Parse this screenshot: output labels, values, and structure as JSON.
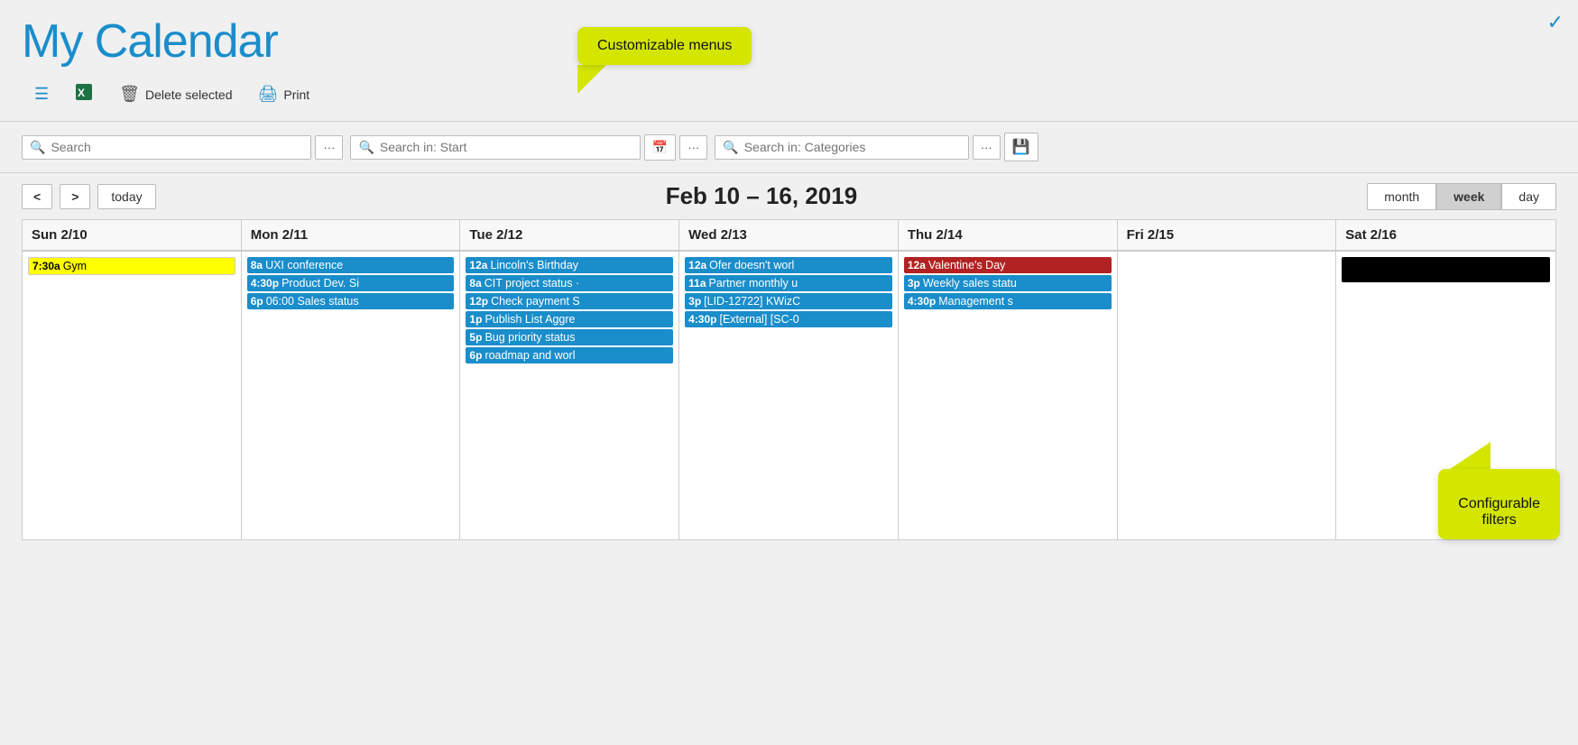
{
  "app": {
    "title": "My Calendar",
    "status_icon": "✓"
  },
  "toolbar": {
    "items_btn": "≡",
    "excel_icon": "𝕏",
    "delete_label": "Delete selected",
    "print_label": "Print"
  },
  "search_bar": {
    "search1_placeholder": "Search",
    "search2_placeholder": "Search in: Start",
    "search3_placeholder": "Search in: Categories",
    "more_label": "···",
    "cal_icon": "📅",
    "save_icon": "💾"
  },
  "calendar_nav": {
    "prev_label": "<",
    "next_label": ">",
    "today_label": "today",
    "date_range": "Feb 10 – 16, 2019",
    "view_month": "month",
    "view_week": "week",
    "view_day": "day"
  },
  "calendar_headers": [
    "Sun 2/10",
    "Mon 2/11",
    "Tue 2/12",
    "Wed 2/13",
    "Thu 2/14",
    "Fri 2/15",
    "Sat 2/16"
  ],
  "calendar_events": {
    "sun": [
      {
        "time": "7:30a",
        "title": "Gym",
        "style": "yellow-highlight"
      }
    ],
    "mon": [
      {
        "time": "8a",
        "title": "UXI conference",
        "style": "blue"
      },
      {
        "time": "4:30p",
        "title": "Product Dev. Si",
        "style": "blue"
      },
      {
        "time": "6p",
        "title": "06:00 Sales status",
        "style": "blue"
      }
    ],
    "tue": [
      {
        "time": "12a",
        "title": "Lincoln's Birthday",
        "style": "blue"
      },
      {
        "time": "8a",
        "title": "CIT project status ·",
        "style": "blue"
      },
      {
        "time": "12p",
        "title": "Check payment S",
        "style": "blue"
      },
      {
        "time": "1p",
        "title": "Publish List Aggre",
        "style": "blue"
      },
      {
        "time": "5p",
        "title": "Bug priority status",
        "style": "blue"
      },
      {
        "time": "6p",
        "title": "roadmap and worl",
        "style": "blue"
      }
    ],
    "wed": [
      {
        "time": "12a",
        "title": "Ofer doesn't worl",
        "style": "blue"
      },
      {
        "time": "11a",
        "title": "Partner monthly u",
        "style": "blue"
      },
      {
        "time": "3p",
        "title": "[LID-12722] KWizC",
        "style": "blue"
      },
      {
        "time": "4:30p",
        "title": "[External] [SC-0",
        "style": "blue"
      }
    ],
    "thu": [
      {
        "time": "12a",
        "title": "Valentine's Day",
        "style": "red"
      },
      {
        "time": "3p",
        "title": "Weekly sales statu",
        "style": "blue"
      },
      {
        "time": "4:30p",
        "title": "Management s",
        "style": "blue"
      }
    ],
    "fri": [],
    "sat": []
  },
  "callouts": {
    "menus_label": "Customizable menus",
    "filters_label": "Configurable\nfilters"
  }
}
